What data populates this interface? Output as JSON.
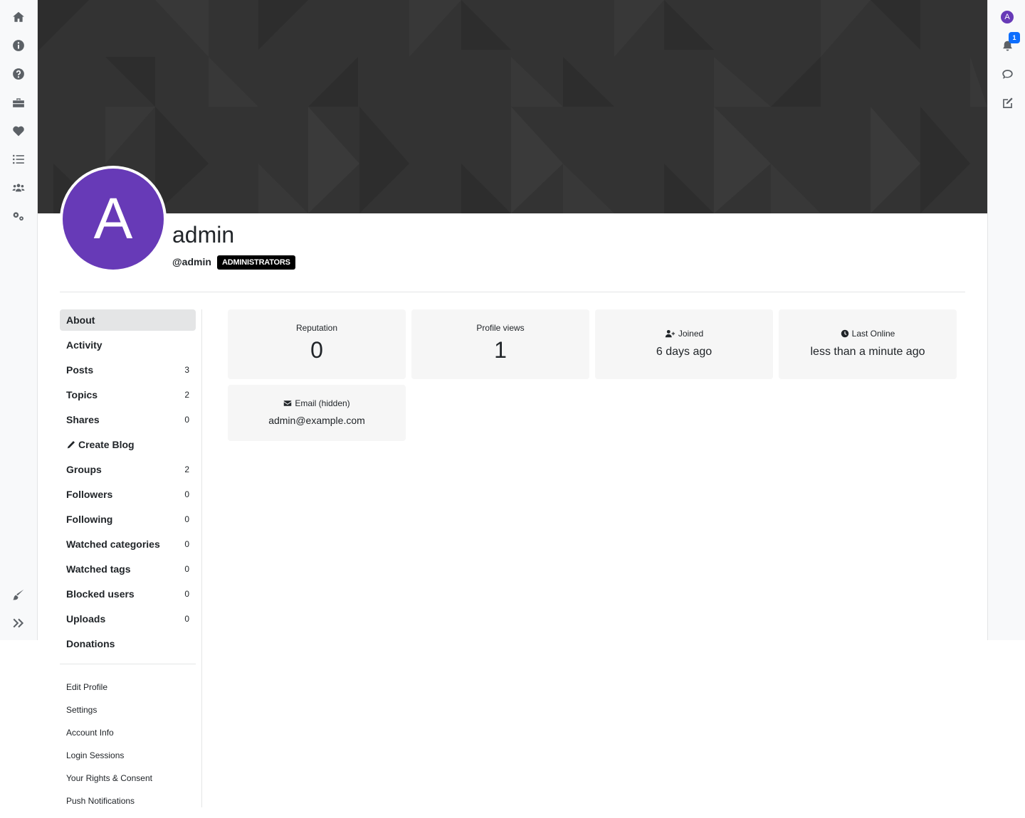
{
  "left_sidebar": {
    "icons": [
      "home-icon",
      "info-icon",
      "question-icon",
      "briefcase-icon",
      "heart-icon",
      "list-icon",
      "users-icon",
      "cogs-icon",
      "brush-icon",
      "expand-icon"
    ]
  },
  "right_sidebar": {
    "avatar_letter": "A",
    "notification_count": "1",
    "icons": [
      "avatar-icon",
      "bell-icon",
      "chat-icon",
      "compose-icon"
    ]
  },
  "profile": {
    "avatar_letter": "A",
    "avatar_color": "#673ab7",
    "display_name": "admin",
    "username": "@admin",
    "group_badge": "ADMINISTRATORS"
  },
  "menu": {
    "items": [
      {
        "label": "About",
        "count": ""
      },
      {
        "label": "Activity",
        "count": ""
      },
      {
        "label": "Posts",
        "count": "3"
      },
      {
        "label": "Topics",
        "count": "2"
      },
      {
        "label": "Shares",
        "count": "0"
      },
      {
        "label": "Create Blog",
        "count": ""
      },
      {
        "label": "Groups",
        "count": "2"
      },
      {
        "label": "Followers",
        "count": "0"
      },
      {
        "label": "Following",
        "count": "0"
      },
      {
        "label": "Watched categories",
        "count": "0"
      },
      {
        "label": "Watched tags",
        "count": "0"
      },
      {
        "label": "Blocked users",
        "count": "0"
      },
      {
        "label": "Uploads",
        "count": "0"
      },
      {
        "label": "Donations",
        "count": ""
      }
    ],
    "settings": [
      "Edit Profile",
      "Settings",
      "Account Info",
      "Login Sessions",
      "Your Rights & Consent",
      "Push Notifications"
    ]
  },
  "stats": {
    "reputation_label": "Reputation",
    "reputation_value": "0",
    "profile_views_label": "Profile views",
    "profile_views_value": "1",
    "joined_label": "Joined",
    "joined_value": "6 days ago",
    "last_online_label": "Last Online",
    "last_online_value": "less than a minute ago",
    "email_label": "Email (hidden)",
    "email_value": "admin@example.com"
  },
  "colors": {
    "accent": "#673ab7",
    "cover_bg": "#333333",
    "badge_bg": "#000000",
    "notification_badge": "#0d6efd",
    "card_bg": "#f6f6f6",
    "sidebar_bg": "#f8f9fa"
  }
}
